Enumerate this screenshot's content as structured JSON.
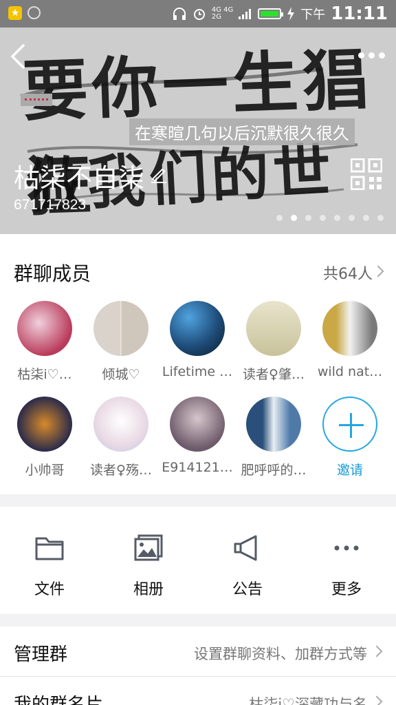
{
  "status_bar": {
    "network_top": "4G 4G",
    "network_bottom": "2G",
    "time_prefix": "下午",
    "time": "11:11"
  },
  "header": {
    "banner_subtitle": "在寒暄几句以后沉默很久很久",
    "calligraphy_line1": "要你一生猖狂",
    "calligraphy_line2": "做我们的世魔王",
    "group_name": "枯柒不自柒",
    "group_id": "671717823",
    "page_dots_count": 8,
    "active_dot": 2
  },
  "members": {
    "title": "群聊成员",
    "count_label": "共64人",
    "list": [
      {
        "name": "枯柒i♡…",
        "avatar_color": "#b93a5a"
      },
      {
        "name": "倾城♡",
        "avatar_color": "#c9c2b8"
      },
      {
        "name": "Lifetime …",
        "avatar_color": "#1f4d7a"
      },
      {
        "name": "读者♀肇…",
        "avatar_color": "#d8d2b4"
      },
      {
        "name": "wild nat…",
        "avatar_color": "#9a8a5c"
      },
      {
        "name": "小帅哥",
        "avatar_color": "#2b2b4a"
      },
      {
        "name": "读者♀殇…",
        "avatar_color": "#e9d9e4"
      },
      {
        "name": "E914121…",
        "avatar_color": "#6d5a6a"
      },
      {
        "name": "肥呼呼的…",
        "avatar_color": "#4f7aa8"
      }
    ],
    "invite_label": "邀请",
    "accent_color": "#23a6e0"
  },
  "tools": [
    {
      "label": "文件",
      "icon": "folder-icon"
    },
    {
      "label": "相册",
      "icon": "album-icon"
    },
    {
      "label": "公告",
      "icon": "megaphone-icon"
    },
    {
      "label": "更多",
      "icon": "more-icon"
    }
  ],
  "rows": {
    "manage": {
      "title": "管理群",
      "value": "设置群聊资料、加群方式等"
    },
    "card": {
      "title": "我的群名片",
      "value": "枯柒i♡深藏功与名"
    }
  }
}
